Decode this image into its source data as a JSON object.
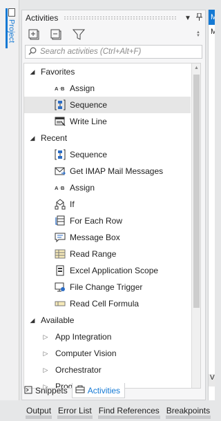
{
  "left_strip": {
    "project_label": "Project"
  },
  "panel": {
    "title": "Activities",
    "title_buttons": {
      "dropdown": "▾",
      "pin": "🖈"
    },
    "search_placeholder": "Search activities (Ctrl+Alt+F)"
  },
  "tree": {
    "favorites": {
      "label": "Favorites",
      "items": [
        "Assign",
        "Sequence",
        "Write Line"
      ]
    },
    "recent": {
      "label": "Recent",
      "items": [
        "Sequence",
        "Get IMAP Mail Messages",
        "Assign",
        "If",
        "For Each Row",
        "Message Box",
        "Read Range",
        "Excel Application Scope",
        "File Change Trigger",
        "Read Cell Formula"
      ]
    },
    "available": {
      "label": "Available",
      "items": [
        "App Integration",
        "Computer Vision",
        "Orchestrator",
        "Programming"
      ]
    }
  },
  "panel_tabs": {
    "snippets": "Snippets",
    "activities": "Activities"
  },
  "bottom_tabs": [
    "Output",
    "Error List",
    "Find References",
    "Breakpoints"
  ],
  "right_panel": {
    "header": "M",
    "line2": "M",
    "footer": "V"
  },
  "colors": {
    "accent": "#1479d4",
    "selected_row": "#e6e6e6"
  }
}
